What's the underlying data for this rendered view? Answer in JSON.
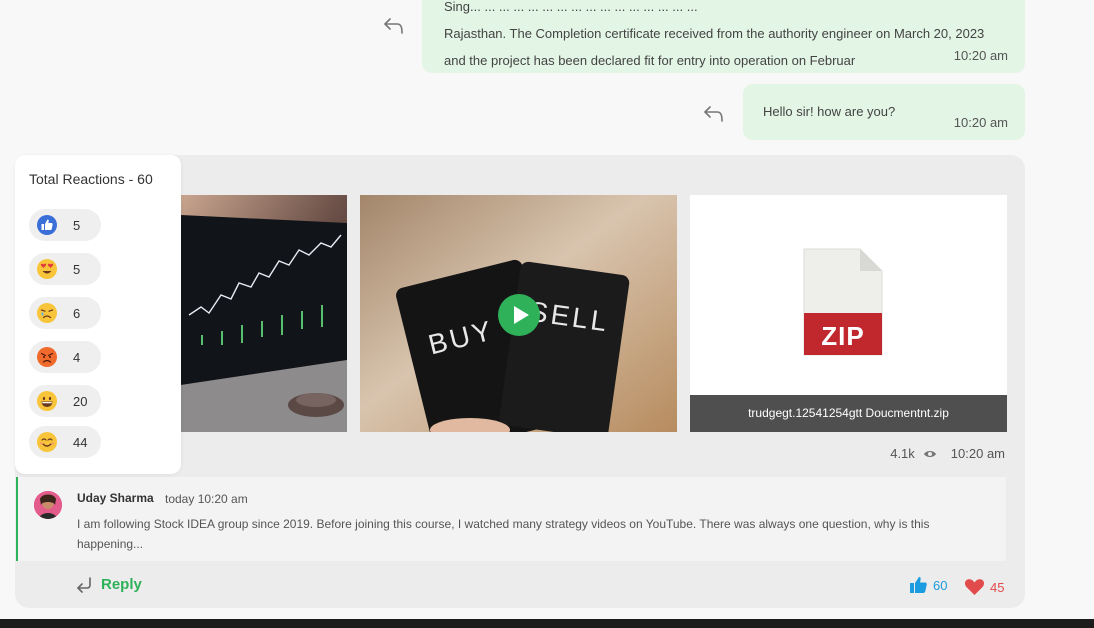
{
  "messages": [
    {
      "lines": [
        "Sing... ... ... ... ... ... ... ... ... ... ... ... ... ... ... ...",
        "Rajasthan. The Completion certificate received from the authority engineer on March 20, 2023",
        "and the project has been declared fit for entry into operation on Februar"
      ],
      "time": "10:20 am"
    },
    {
      "text": "Hello sir! how are you?",
      "time": "10:20 am"
    }
  ],
  "media": {
    "zip_filename": "trudgegt.12541254gtt Doucmentnt.zip",
    "zip_badge": "ZIP",
    "views": "4.1k",
    "time": "10:20 am"
  },
  "reactions": {
    "title": "Total Reactions - 60",
    "items": [
      {
        "icon": "thumbs-up-icon",
        "count": "5"
      },
      {
        "icon": "heart-eyes-emoji-icon",
        "count": "5"
      },
      {
        "icon": "sad-emoji-icon",
        "count": "6"
      },
      {
        "icon": "angry-emoji-icon",
        "count": "4"
      },
      {
        "icon": "grin-emoji-icon",
        "count": "20"
      },
      {
        "icon": "smile-emoji-icon",
        "count": "44"
      }
    ]
  },
  "comment": {
    "author": "Uday Sharma",
    "time": "today 10:20 am",
    "text": "I am following Stock IDEA group since 2019. Before joining this course, I watched many strategy videos on YouTube. There was always one question, why is this happening...",
    "reply_label": "Reply",
    "likes": "60",
    "hearts": "45"
  },
  "colors": {
    "accent_green": "#2fb15a",
    "bubble_green": "#e3f5e4",
    "like_blue": "#1b9be0",
    "heart_red": "#e24b4b"
  }
}
